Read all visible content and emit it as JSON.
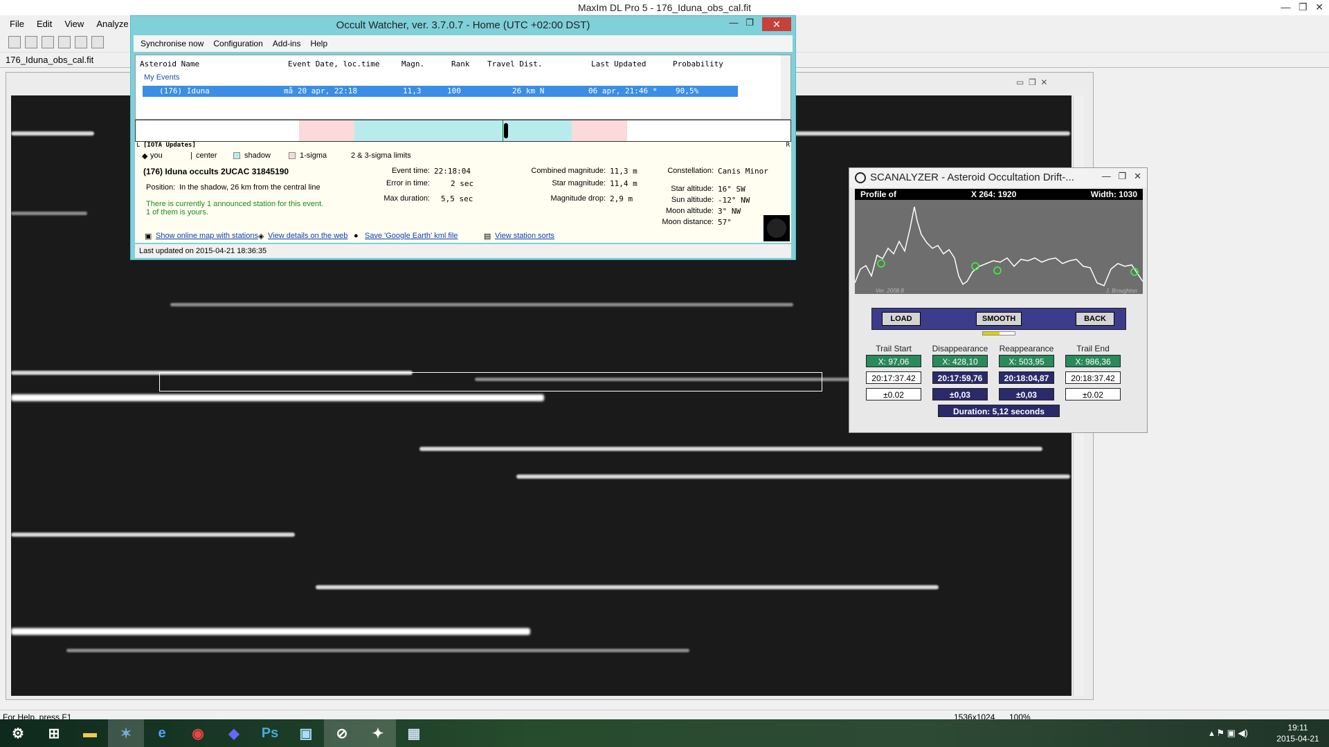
{
  "app": {
    "title": "MaxIm DL Pro 5 - 176_Iduna_obs_cal.fit",
    "menu": [
      "File",
      "Edit",
      "View",
      "Analyze"
    ],
    "doc_tab": "176_Iduna_obs_cal.fit",
    "status_help": "For Help, press F1",
    "status_dims": "1536x1024",
    "status_zoom": "100%"
  },
  "occult": {
    "title": "Occult Watcher, ver. 3.7.0.7 - Home (UTC +02:00 DST)",
    "close_glyph": "✕",
    "menu": [
      "Synchronise now",
      "Configuration",
      "Add-ins",
      "Help"
    ],
    "columns": [
      "Asteroid Name",
      "Event Date, loc.time",
      "Magn.",
      "Rank",
      "Travel Dist.",
      "Last Updated",
      "Probability"
    ],
    "group_label": "My Events",
    "row": {
      "name": "(176) Iduna",
      "date": "må 20 apr, 22:18",
      "magn": "11,3",
      "rank": "100",
      "travel": "26 km N",
      "updated": "06 apr, 21:46 *",
      "probability": "90,5%"
    },
    "graph_left": "L",
    "graph_right": "R",
    "iota_label": "[IOTA Updates]",
    "legend": [
      "you",
      "center",
      "shadow",
      "1-sigma",
      "2 & 3-sigma limits"
    ],
    "event_title": "(176) Iduna occults 2UCAC 31845190",
    "position_label": "Position:",
    "position_value": "In the shadow, 26 km from the central line",
    "stations_line1": "There is currently 1 announced station for this event.",
    "stations_line2": "1 of them is yours.",
    "event_time_label": "Event time:",
    "event_time_value": "22:18:04",
    "error_label": "Error in time:",
    "error_value": "2 sec",
    "maxdur_label": "Max duration:",
    "maxdur_value": "5,5 sec",
    "combmag_label": "Combined magnitude:",
    "combmag_value": "11,3 m",
    "starmag_label": "Star magnitude:",
    "starmag_value": "11,4 m",
    "magdrop_label": "Magnitude drop:",
    "magdrop_value": "2,9 m",
    "constellation_label": "Constellation:",
    "constellation_value": "Canis Minor",
    "star_alt_label": "Star altitude:",
    "star_alt_value": "16° SW",
    "sun_alt_label": "Sun altitude:",
    "sun_alt_value": "-12° NW",
    "moon_alt_label": "Moon altitude:",
    "moon_alt_value": "3° NW",
    "moon_dist_label": "Moon distance:",
    "moon_dist_value": "57°",
    "links": [
      "Show online map with stations",
      "View details on the web",
      "Save 'Google Earth' kml file",
      "View station sorts"
    ],
    "status": "Last updated on 2015-04-21 18:36:35"
  },
  "scanalyzer": {
    "title": "SCANALYZER - Asteroid Occultation Drift-...",
    "graph_head_left": "Profile of",
    "graph_head_mid": "X 264: 1920",
    "graph_head_right": "Width: 1030",
    "graph_foot_left": "Ver. 2008.8",
    "graph_foot_right": "J. Broughton",
    "load": "LOAD",
    "smooth": "SMOOTH",
    "back": "BACK",
    "cols": [
      {
        "label": "Trail Start",
        "x": "X: 97,06",
        "time": "20:17:37.42",
        "err": "±0.02"
      },
      {
        "label": "Disappearance",
        "x": "X: 428,10",
        "time": "20:17:59,76",
        "err": "±0,03"
      },
      {
        "label": "Reappearance",
        "x": "X: 503,95",
        "time": "20:18:04,87",
        "err": "±0,03"
      },
      {
        "label": "Trail End",
        "x": "X: 986,36",
        "time": "20:18:37.42",
        "err": "±0.02"
      }
    ],
    "duration": "Duration: 5,12 seconds"
  },
  "taskbar": {
    "clock_time": "19:11",
    "clock_date": "2015-04-21"
  }
}
